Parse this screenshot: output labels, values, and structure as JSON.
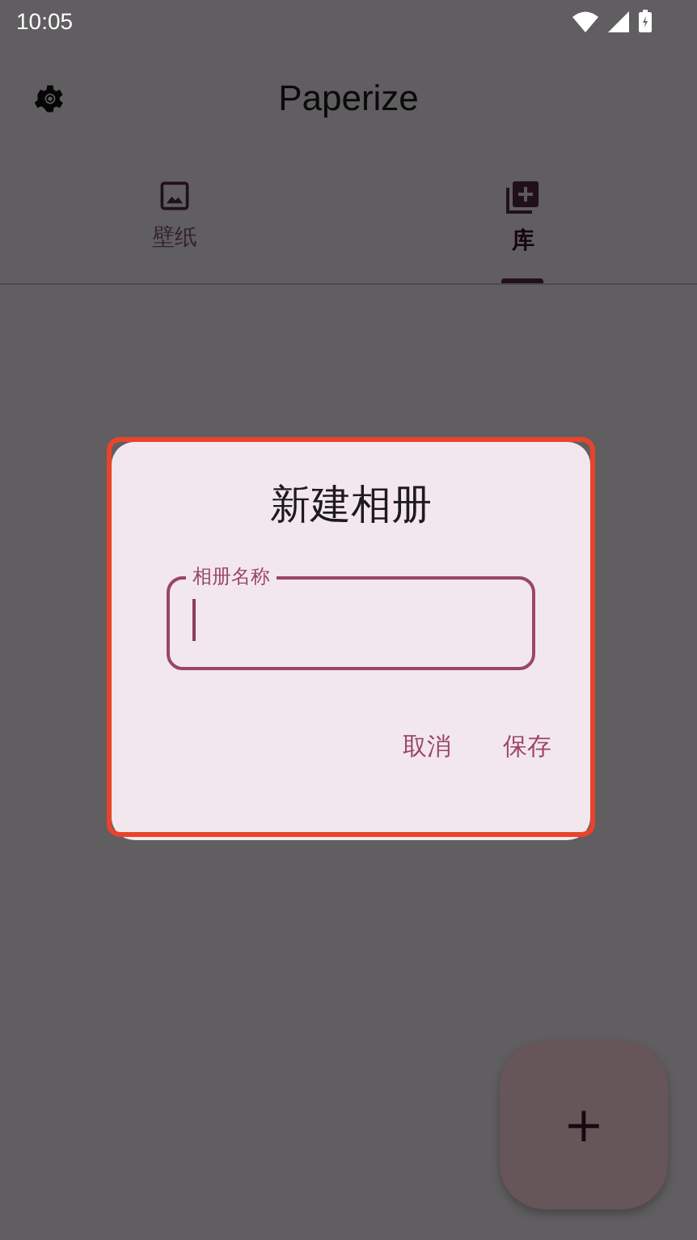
{
  "status_bar": {
    "time": "10:05"
  },
  "app_bar": {
    "title": "Paperize"
  },
  "tabs": [
    {
      "label": "壁纸",
      "kind": "wallpaper",
      "selected": false
    },
    {
      "label": "库",
      "kind": "library",
      "selected": true
    }
  ],
  "dialog": {
    "title": "新建相册",
    "field": {
      "label": "相册名称",
      "focused": true
    },
    "buttons": [
      "取消",
      "保存"
    ],
    "highlighted": true
  },
  "fab": {
    "icon": "+"
  }
}
